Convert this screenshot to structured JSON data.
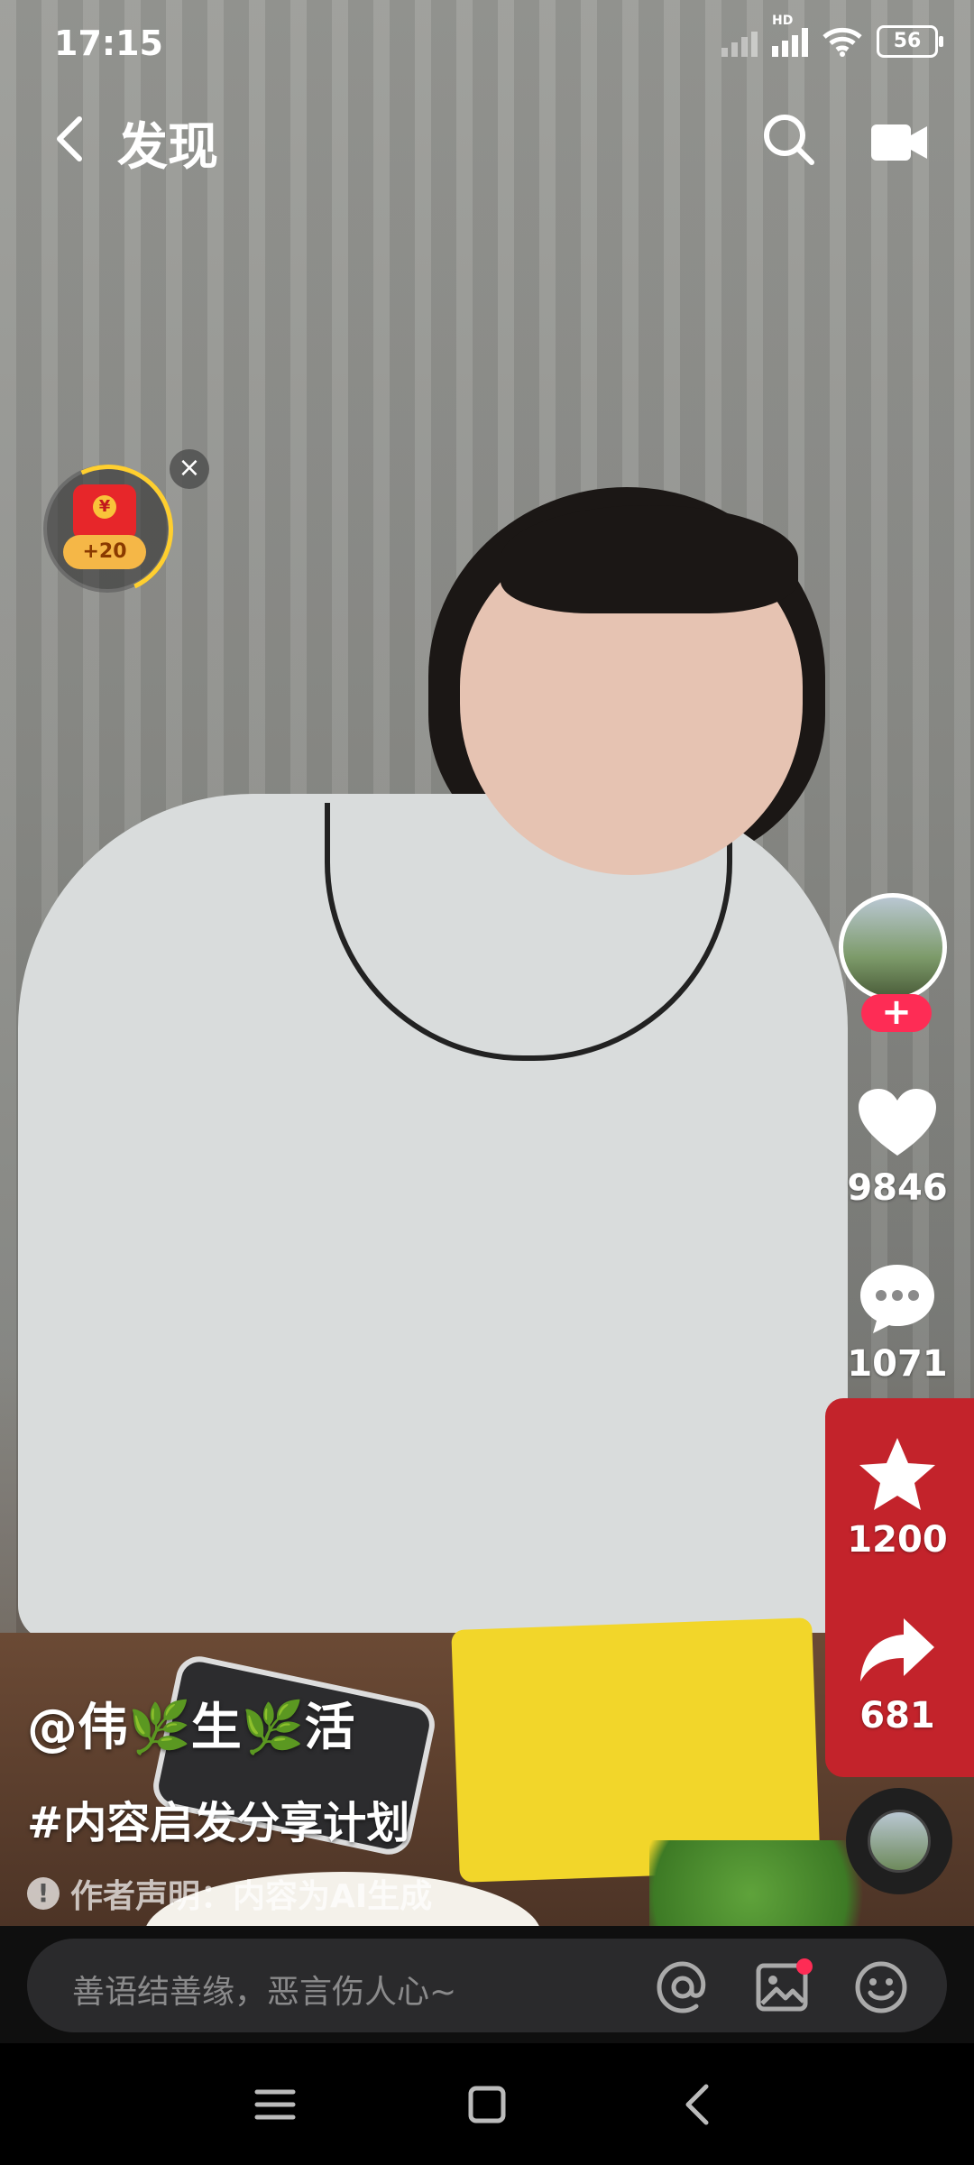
{
  "status_bar": {
    "time": "17:15",
    "network": "HD",
    "battery": "56"
  },
  "header": {
    "title": "发现"
  },
  "reward": {
    "bonus": "+20"
  },
  "author": {
    "name": "@伟🌿生🌿活"
  },
  "caption": {
    "topic": "#内容启发分享计划",
    "disclaimer": "作者声明：内容为AI生成"
  },
  "actions": {
    "likes": "9846",
    "comments": "1071",
    "favorites": "1200",
    "shares": "681"
  },
  "comment_bar": {
    "placeholder": "善语结善缘，恶言伤人心~"
  },
  "colors": {
    "accent": "#fe2c55",
    "reward_ring": "#ffcf2f"
  }
}
